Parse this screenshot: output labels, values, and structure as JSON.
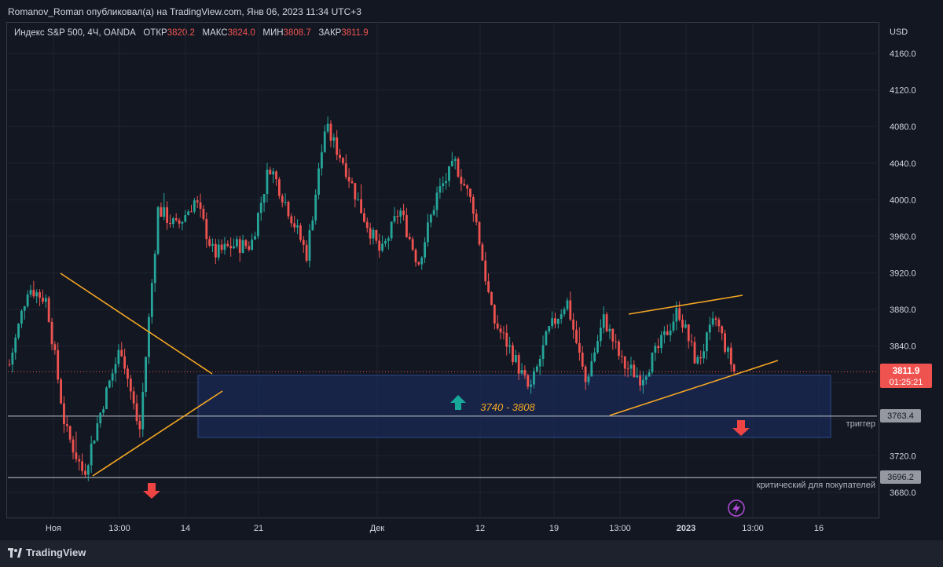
{
  "header": {
    "publisher_line": "Romanov_Roman опубликовал(а) на TradingView.com, Янв 06, 2023 11:34 UTC+3"
  },
  "legend": {
    "symbol": "Индекс S&P 500, 4Ч, OANDA",
    "open_label": "ОТКР",
    "open_value": "3820.2",
    "high_label": "МАКС",
    "high_value": "3824.0",
    "low_label": "МИН",
    "low_value": "3808.7",
    "close_label": "ЗАКР",
    "close_value": "3811.9"
  },
  "price_axis": {
    "currency": "USD",
    "current_price": "3811.9",
    "countdown": "01:25:21",
    "trigger_level": "3763.4",
    "critical_level": "3696.2"
  },
  "annotations": {
    "zone_label": "3740 - 3808",
    "trigger_text": "триггер",
    "critical_text": "критический для покупателей"
  },
  "footer": {
    "brand": "TradingView"
  },
  "colors": {
    "bull": "#26a69a",
    "bear": "#ef5350",
    "pattern": "#f5a623",
    "zone_fill": "#1a2a55",
    "zone_border": "#2f4a8a",
    "background": "#131722"
  },
  "chart_data": {
    "type": "candlestick",
    "symbol": "Индекс S&P 500",
    "interval": "4Ч",
    "ylim": [
      3655,
      4180
    ],
    "y_ticks": [
      3680.0,
      3720.0,
      3760.0,
      3800.0,
      3840.0,
      3880.0,
      3920.0,
      3960.0,
      4000.0,
      4040.0,
      4080.0,
      4120.0,
      4160.0
    ],
    "y_tick_labels": [
      "3680.0",
      "3720.0",
      "",
      "",
      "3840.0",
      "3880.0",
      "3920.0",
      "3960.0",
      "4000.0",
      "4040.0",
      "4080.0",
      "4120.0",
      "4160.0"
    ],
    "x_tick_labels": [
      "Ноя",
      "13:00",
      "14",
      "21",
      "Дек",
      "12",
      "19",
      "13:00",
      "2023",
      "13:00",
      "16"
    ],
    "horizontal_levels": [
      {
        "name": "триггер",
        "value": 3763.4
      },
      {
        "name": "критический для покупателей",
        "value": 3696.2
      }
    ],
    "zone": {
      "low": 3740,
      "high": 3808
    },
    "last_price": 3811.9,
    "series_path": [
      [
        3845,
        3820
      ],
      [
        3910,
        3905
      ],
      [
        3860,
        3890
      ],
      [
        3790,
        3750
      ],
      [
        3710,
        3700
      ],
      [
        3760,
        3775
      ],
      [
        3850,
        3840
      ],
      [
        3750,
        3745
      ],
      [
        3955,
        3990
      ],
      [
        3990,
        3970
      ],
      [
        4030,
        4000
      ],
      [
        3930,
        3940
      ],
      [
        3960,
        3950
      ],
      [
        3930,
        3950
      ],
      [
        4030,
        4038
      ],
      [
        4005,
        3990
      ],
      [
        3945,
        3940
      ],
      [
        4085,
        4080
      ],
      [
        4060,
        4040
      ],
      [
        3995,
        3985
      ],
      [
        3920,
        3940
      ],
      [
        3980,
        3990
      ],
      [
        3925,
        3930
      ],
      [
        4000,
        4005
      ],
      [
        4140,
        4040
      ],
      [
        4005,
        3990
      ],
      [
        3880,
        3870
      ],
      [
        3840,
        3835
      ],
      [
        3810,
        3790
      ],
      [
        3850,
        3855
      ],
      [
        3888,
        3890
      ],
      [
        3775,
        3800
      ],
      [
        3875,
        3870
      ],
      [
        3830,
        3820
      ],
      [
        3800,
        3805
      ],
      [
        3850,
        3840
      ],
      [
        3885,
        3880
      ],
      [
        3810,
        3820
      ],
      [
        3865,
        3870
      ],
      [
        3820,
        3812
      ]
    ]
  }
}
